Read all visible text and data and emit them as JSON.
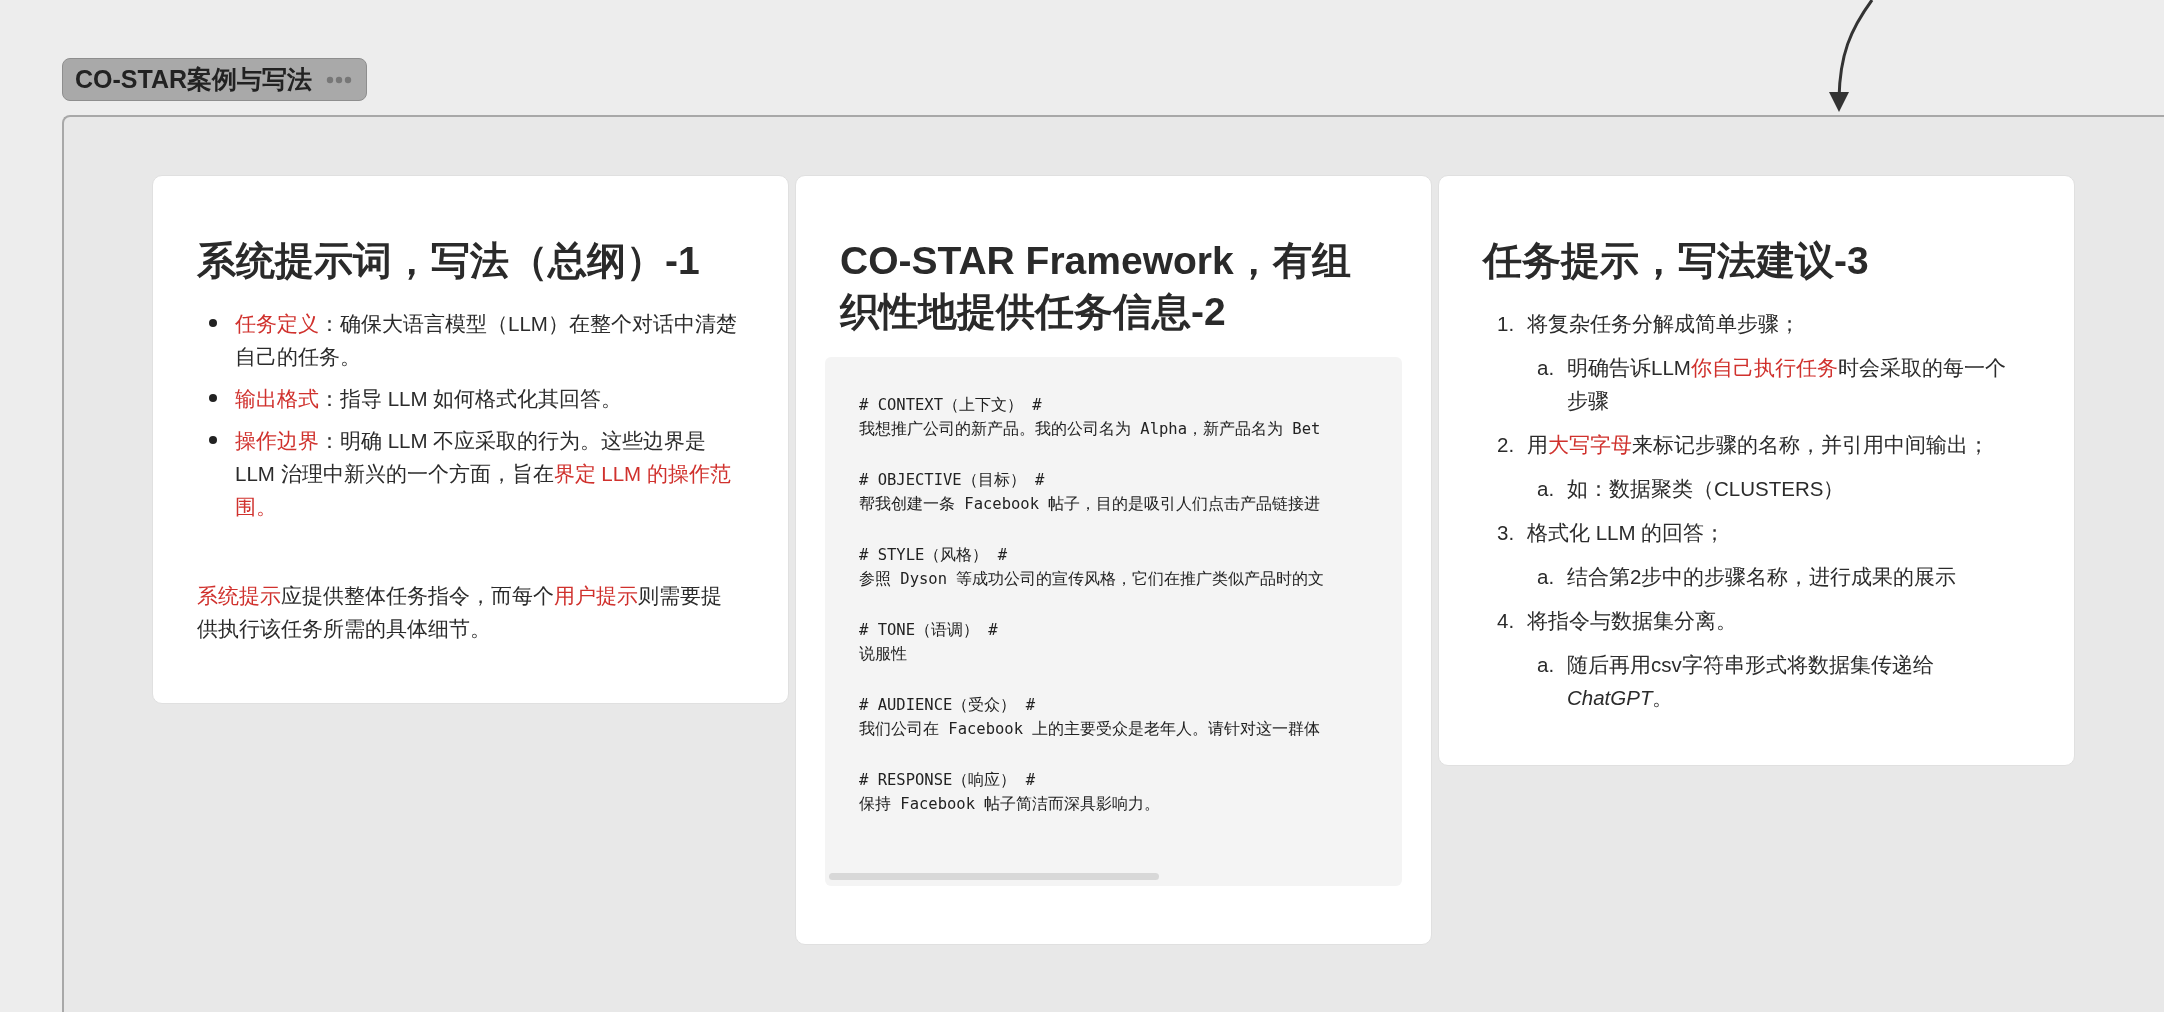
{
  "group": {
    "title": "CO-STAR案例与写法"
  },
  "cards": [
    {
      "kind": "bullets",
      "title": "系统提示词，写法（总纲）-1",
      "items": [
        {
          "segments": [
            {
              "text": "任务定义",
              "highlight": true
            },
            {
              "text": "：确保大语言模型（LLM）在整个对话中清楚自己的任务。",
              "highlight": false
            }
          ]
        },
        {
          "segments": [
            {
              "text": "输出格式",
              "highlight": true
            },
            {
              "text": "：指导 LLM 如何格式化其回答。",
              "highlight": false
            }
          ]
        },
        {
          "segments": [
            {
              "text": "操作边界",
              "highlight": true
            },
            {
              "text": "：明确 LLM 不应采取的行为。这些边界是 LLM 治理中新兴的一个方面，旨在",
              "highlight": false
            },
            {
              "text": "界定 LLM 的操作范围。",
              "highlight": true
            }
          ]
        }
      ],
      "paragraph": [
        {
          "text": "系统提示",
          "highlight": true
        },
        {
          "text": "应提供整体任务指令，而每个",
          "highlight": false
        },
        {
          "text": "用户提示",
          "highlight": true
        },
        {
          "text": "则需要提供执行该任务所需的具体细节。",
          "highlight": false
        }
      ]
    },
    {
      "kind": "code",
      "title": "CO-STAR Framework，有组织性地提供任务信息-2",
      "sections": [
        {
          "header": "# CONTEXT（上下文） #",
          "body": "我想推广公司的新产品。我的公司名为 Alpha，新产品名为 Bet"
        },
        {
          "header": "# OBJECTIVE（目标） #",
          "body": "帮我创建一条 Facebook 帖子，目的是吸引人们点击产品链接进"
        },
        {
          "header": "# STYLE（风格） #",
          "body": "参照 Dyson 等成功公司的宣传风格，它们在推广类似产品时的文"
        },
        {
          "header": "# TONE（语调） #",
          "body": "说服性"
        },
        {
          "header": "# AUDIENCE（受众） #",
          "body": "我们公司在 Facebook 上的主要受众是老年人。请针对这一群体"
        },
        {
          "header": "# RESPONSE（响应） #",
          "body": "保持 Facebook 帖子简洁而深具影响力。"
        }
      ]
    },
    {
      "kind": "numbered",
      "title": "任务提示，写法建议-3",
      "items": [
        {
          "marker": "1.",
          "segments": [
            {
              "text": "将复杂任务分解成简单步骤；",
              "highlight": false
            }
          ],
          "children": [
            {
              "marker": "a.",
              "segments": [
                {
                  "text": "明确告诉LLM",
                  "highlight": false
                },
                {
                  "text": "你自己执行任务",
                  "highlight": true
                },
                {
                  "text": "时会采取的每一个步骤",
                  "highlight": false
                }
              ]
            }
          ]
        },
        {
          "marker": "2.",
          "segments": [
            {
              "text": "用",
              "highlight": false
            },
            {
              "text": "大写字母",
              "highlight": true
            },
            {
              "text": "来标记步骤的名称，并引用中间输出；",
              "highlight": false
            }
          ],
          "children": [
            {
              "marker": "a.",
              "segments": [
                {
                  "text": "如：数据聚类（CLUSTERS）",
                  "highlight": false
                }
              ]
            }
          ]
        },
        {
          "marker": "3.",
          "segments": [
            {
              "text": "格式化 LLM 的回答；",
              "highlight": false
            }
          ],
          "children": [
            {
              "marker": "a.",
              "segments": [
                {
                  "text": "结合第2步中的步骤名称，进行成果的展示",
                  "highlight": false
                }
              ]
            }
          ]
        },
        {
          "marker": "4.",
          "segments": [
            {
              "text": "将指令与数据集分离。",
              "highlight": false
            }
          ],
          "children": [
            {
              "marker": "a.",
              "segments": [
                {
                  "text": "随后再用csv字符串形式将数据集传递给",
                  "highlight": false
                },
                {
                  "text": "ChatGPT",
                  "highlight": false,
                  "italic": true
                },
                {
                  "text": "。",
                  "highlight": false
                }
              ]
            }
          ]
        }
      ]
    }
  ]
}
